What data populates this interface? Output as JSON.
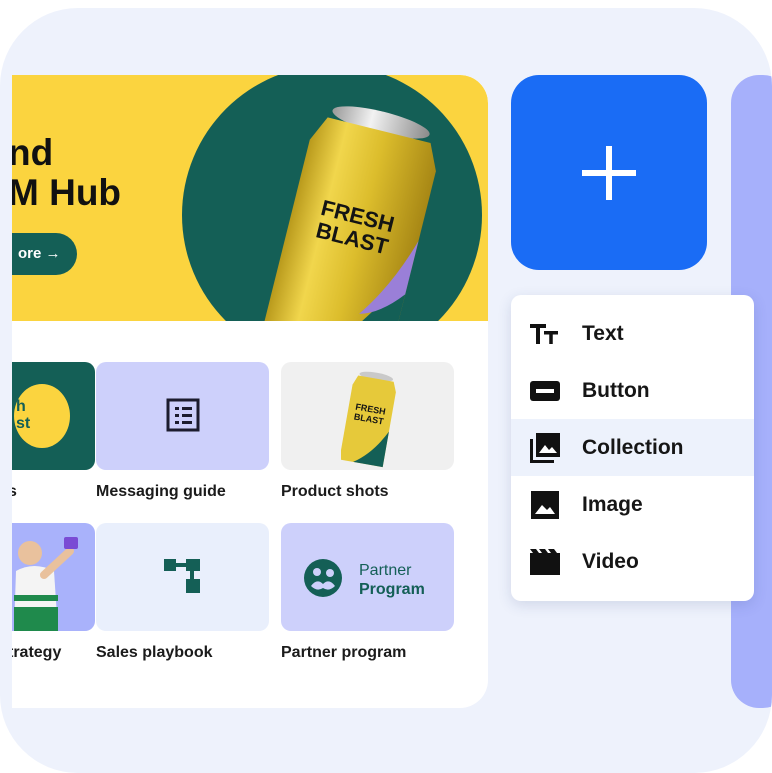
{
  "banner": {
    "title_line1": "nd",
    "title_line2": "M Hub",
    "button_label": "ore →",
    "can_text_line1": "FRESH",
    "can_text_line2": "BLAST"
  },
  "tiles": [
    {
      "label": "s",
      "badge_line1": "h",
      "badge_line2": "st"
    },
    {
      "label": "Messaging guide"
    },
    {
      "label": "Product shots",
      "can_text_line1": "FRESH",
      "can_text_line2": "BLAST"
    },
    {
      "label": "trategy"
    },
    {
      "label": "Sales playbook"
    },
    {
      "label": "Partner program",
      "logo_line1": "Partner",
      "logo_line2": "Program"
    }
  ],
  "menu": {
    "items": [
      {
        "label": "Text",
        "icon": "text-icon"
      },
      {
        "label": "Button",
        "icon": "button-icon"
      },
      {
        "label": "Collection",
        "icon": "collection-icon",
        "active": true
      },
      {
        "label": "Image",
        "icon": "image-icon"
      },
      {
        "label": "Video",
        "icon": "video-icon"
      }
    ]
  },
  "colors": {
    "accent_blue": "#1a6cf5",
    "brand_green": "#145f56",
    "brand_yellow": "#fbd43f",
    "lavender": "#a6b0fb",
    "page_bg": "#eef2fc"
  }
}
